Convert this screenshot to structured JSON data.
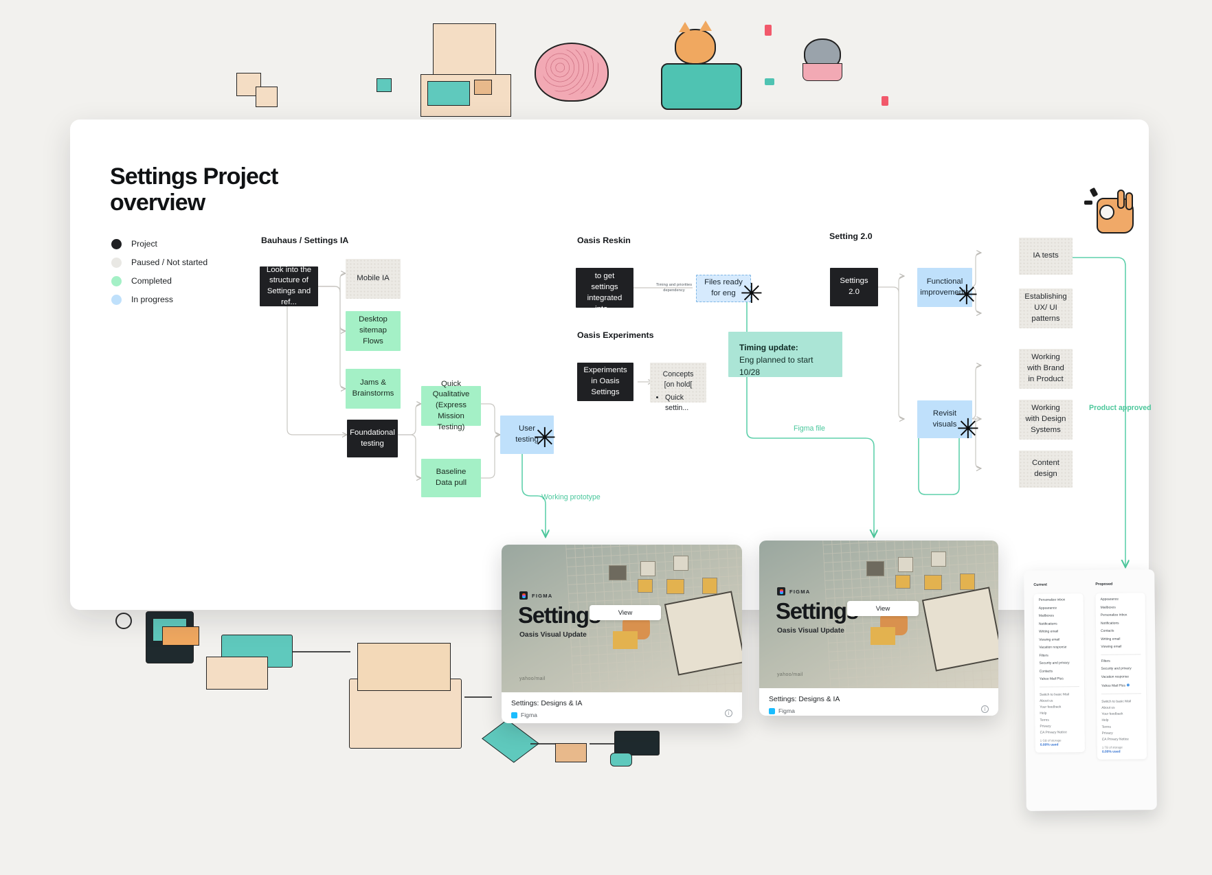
{
  "page": {
    "title": "Settings Project\noverview"
  },
  "legend": {
    "items": [
      {
        "label": "Project",
        "color": "#1f2023"
      },
      {
        "label": "Paused / Not started",
        "color": "#e9e8e4"
      },
      {
        "label": "Completed",
        "color": "#a4f0c6"
      },
      {
        "label": "In progress",
        "color": "#bfe0fb"
      }
    ]
  },
  "columns": {
    "bauhaus": {
      "heading": "Bauhaus / Settings IA"
    },
    "oasis_reskin": {
      "heading": "Oasis Reskin"
    },
    "oasis_experiments": {
      "heading": "Oasis Experiments"
    },
    "settings_two": {
      "heading": "Setting 2.0"
    }
  },
  "nodes": {
    "look_into": "Look into the structure of Settings and ref...",
    "mobile_ia": "Mobile IA",
    "desktop_sitemap": "Desktop sitemap Flows",
    "jams": "Jams & Brainstorms",
    "foundational": "Foundational testing",
    "quick_qual": "Quick Qualitative (Express Mission Testing)",
    "baseline": "Baseline Data pull",
    "user_testing": "User testing",
    "visual_reskin": "Visual reskin to get settings integrated into...",
    "files_ready": "Files ready for eng",
    "experiments": "Experiments in Oasis Settings",
    "concepts_title": "Concepts [on hold[",
    "concepts_bullets": [
      "Quick settin..."
    ],
    "settings_20": "Settings 2.0",
    "functional": "Functional improvements",
    "revisit": "Revisit visuals",
    "ia_tests": "IA tests",
    "establishing": "Establishing UX/ UI patterns",
    "brand": "Working with Brand in Product",
    "design_systems": "Working with Design Systems",
    "content_design": "Content design"
  },
  "callouts": {
    "timing_update_title": "Timing update:",
    "timing_update_body": "Eng planned to start 10/28"
  },
  "edge_labels": {
    "dependency": "Timing and priorities\ndependency",
    "working_prototype": "Working prototype",
    "figma_file": "Figma file",
    "product_approved": "Product approved"
  },
  "figma_cards": [
    {
      "badge": "FIGMA",
      "title": "Settings",
      "subtitle": "Oasis Visual Update",
      "watermark": "yahoo/mail",
      "view_label": "View",
      "footer_title": "Settings: Designs & IA",
      "footer_source": "Figma"
    },
    {
      "badge": "FIGMA",
      "title": "Settings",
      "subtitle": "Oasis Visual Update",
      "watermark": "yahoo/mail",
      "view_label": "View",
      "footer_title": "Settings: Designs & IA",
      "footer_source": "Figma"
    }
  ],
  "compare_panel": {
    "current": {
      "heading": "Current",
      "items": [
        "Personalize inbox",
        "Appearance",
        "Mailboxes",
        "Notifications",
        "Writing email",
        "Viewing email",
        "Vacation response",
        "Filters",
        "Security and privacy",
        "Contacts",
        "Yahoo Mail Plus"
      ],
      "footer": [
        "Switch to basic Mail",
        "About us",
        "Your feedback",
        "Help",
        "Terms",
        "Privacy",
        "CA Privacy Notice"
      ],
      "note": "1 GB of storage",
      "link": "0.00% used"
    },
    "proposed": {
      "heading": "Proposed",
      "items_a": [
        "Appearance",
        "Mailboxes",
        "Personalize inbox",
        "Notifications",
        "Contacts",
        "Writing email",
        "Viewing email"
      ],
      "items_b": [
        "Filters",
        "Security and privacy",
        "Vacation response",
        "Yahoo Mail Plus"
      ],
      "footer": [
        "Switch to basic Mail",
        "About us",
        "Your feedback",
        "Help",
        "Terms",
        "Privacy",
        "CA Privacy Notice"
      ],
      "note": "1 TB of storage",
      "link": "0.00% used"
    }
  },
  "colors": {
    "green": "#a4f0c6",
    "blue": "#bfe0fb",
    "teal_line": "#4cc79b",
    "dark": "#1f2023",
    "grey": "#eceae5"
  }
}
